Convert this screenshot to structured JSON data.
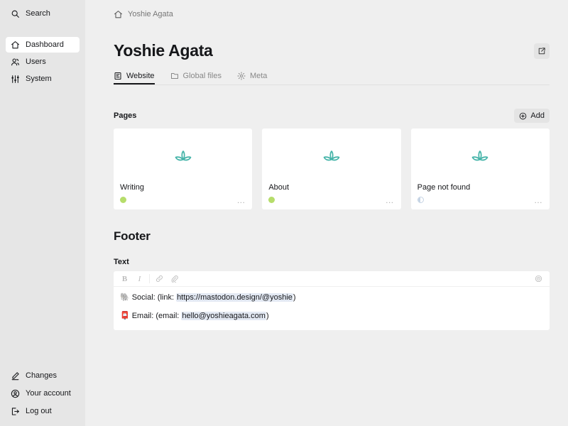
{
  "sidebar": {
    "search": {
      "label": "Search",
      "icon": "search-icon"
    },
    "nav": [
      {
        "label": "Dashboard",
        "icon": "home-icon",
        "active": true
      },
      {
        "label": "Users",
        "icon": "users-icon",
        "active": false
      },
      {
        "label": "System",
        "icon": "sliders-icon",
        "active": false
      }
    ],
    "bottom": [
      {
        "label": "Changes",
        "icon": "pencil-icon"
      },
      {
        "label": "Your account",
        "icon": "account-icon"
      },
      {
        "label": "Log out",
        "icon": "logout-icon"
      }
    ]
  },
  "breadcrumb": {
    "label": "Yoshie Agata",
    "icon": "home-icon"
  },
  "header": {
    "title": "Yoshie Agata",
    "open_button_icon": "external-link-icon"
  },
  "tabs": [
    {
      "label": "Website",
      "icon": "pages-icon",
      "active": true
    },
    {
      "label": "Global files",
      "icon": "folder-icon",
      "active": false
    },
    {
      "label": "Meta",
      "icon": "gear-icon",
      "active": false
    }
  ],
  "pages_section": {
    "label": "Pages",
    "add_label": "Add",
    "add_icon": "circle-plus-icon",
    "cards": [
      {
        "title": "Writing",
        "status": "listed",
        "figure_icon": "lotus-icon",
        "options": "…"
      },
      {
        "title": "About",
        "status": "listed",
        "figure_icon": "lotus-icon",
        "options": "…"
      },
      {
        "title": "Page not found",
        "status": "draft",
        "figure_icon": "lotus-icon",
        "options": "…"
      }
    ]
  },
  "footer_section": {
    "heading": "Footer",
    "field_label": "Text",
    "toolbar": [
      {
        "name": "bold-icon",
        "glyph": "B"
      },
      {
        "name": "italic-icon",
        "glyph": "I"
      },
      {
        "name": "link-icon",
        "glyph": ""
      },
      {
        "name": "attachment-icon",
        "glyph": ""
      }
    ],
    "toolbar_right_icon": "target-icon",
    "lines": [
      {
        "emoji": "🐘",
        "prefix": "Social: (link: ",
        "link": "https://mastodon.design/@yoshie",
        "suffix": ")"
      },
      {
        "emoji": "📮",
        "prefix": "Email: (email: ",
        "link": "hello@yoshieagata.com",
        "suffix": ")"
      }
    ]
  },
  "colors": {
    "background": "#efefef",
    "sidebar": "#e6e6e6",
    "card": "#ffffff",
    "accent_teal": "#43b3a8",
    "status_listed": "#b6dd6b",
    "status_draft": "#c4d3e4",
    "text": "#16171a",
    "muted": "#888888"
  }
}
